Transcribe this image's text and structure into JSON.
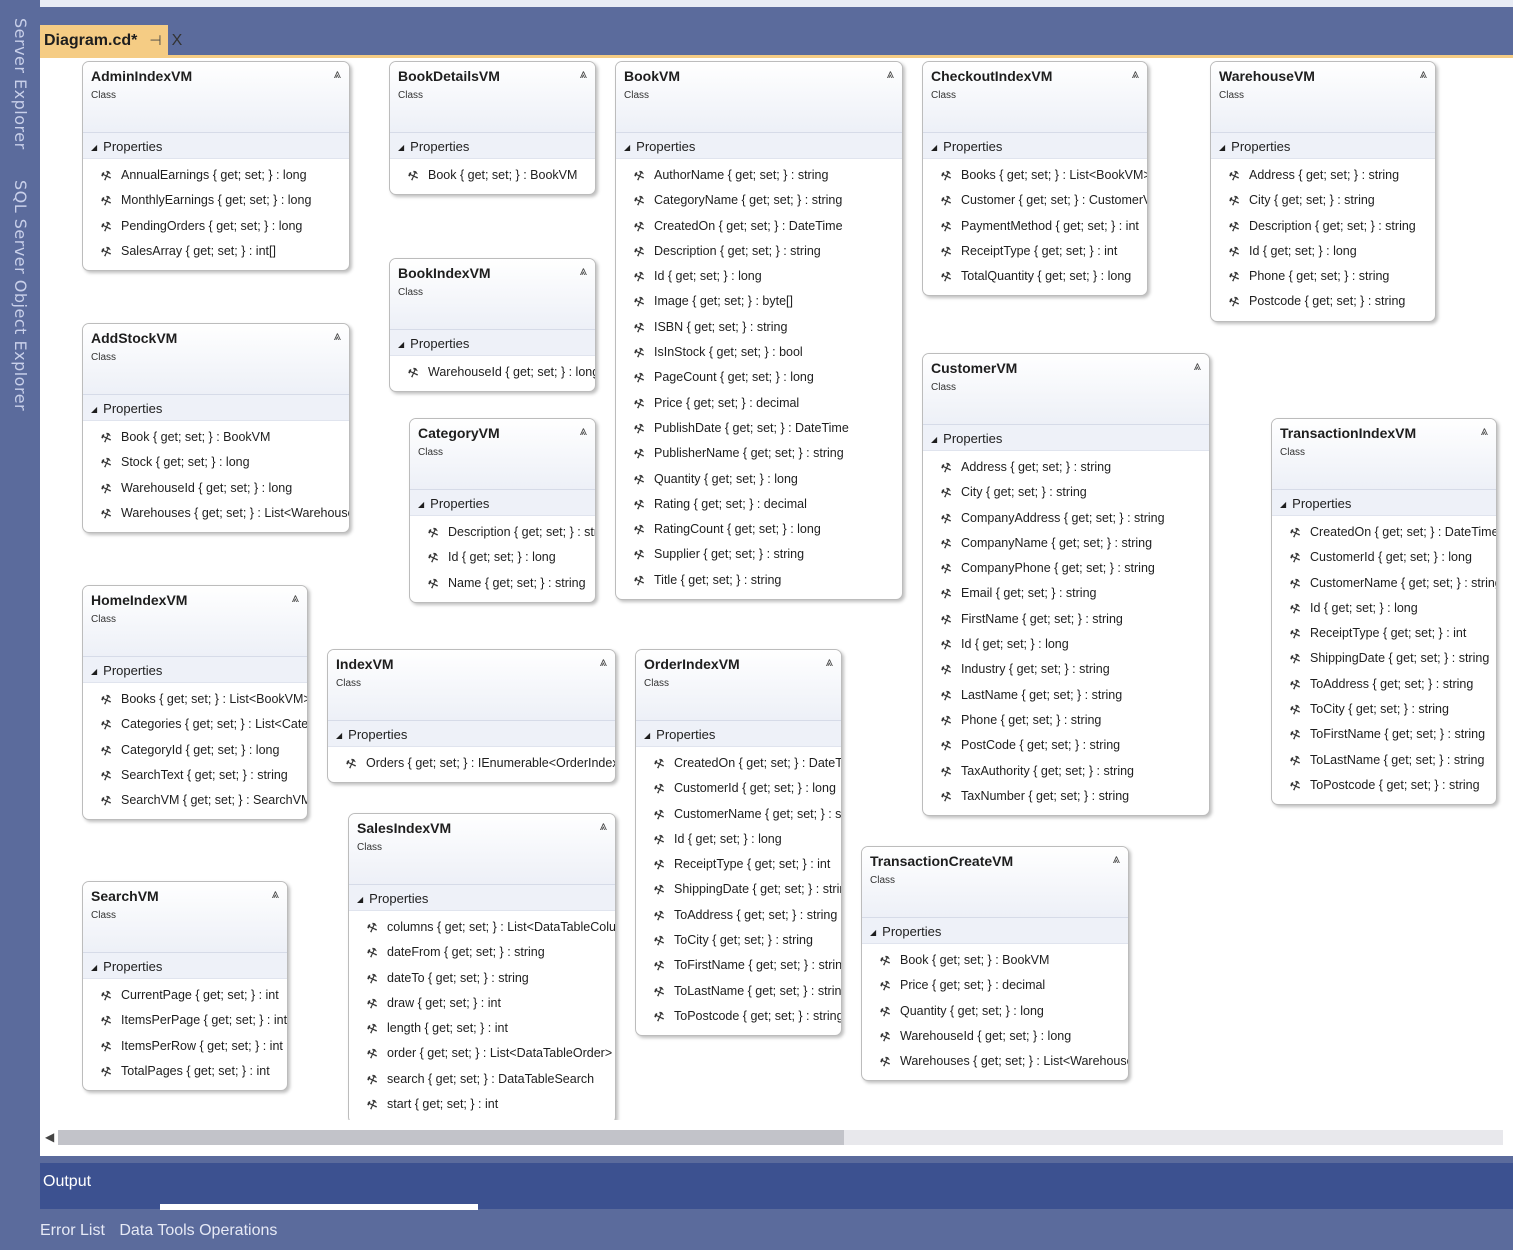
{
  "side_tabs": {
    "server": "Server Explorer",
    "sql": "SQL Server Object Explorer"
  },
  "document_tab": {
    "title": "Diagram.cd*",
    "pin": "⊣",
    "close": "X"
  },
  "section_label": "Properties",
  "class_kind": "Class",
  "classes": {
    "AdminIndexVM": {
      "name": "AdminIndexVM",
      "props": [
        "AnnualEarnings { get; set; } : long",
        "MonthlyEarnings { get; set; } : long",
        "PendingOrders { get; set; } : long",
        "SalesArray { get; set; } : int[]"
      ]
    },
    "AddStockVM": {
      "name": "AddStockVM",
      "props": [
        "Book { get; set; } : BookVM",
        "Stock { get; set; } : long",
        "WarehouseId { get; set; } : long",
        "Warehouses { get; set; } : List<WarehouseVM>"
      ]
    },
    "HomeIndexVM": {
      "name": "HomeIndexVM",
      "props": [
        "Books { get; set; } : List<BookVM>",
        "Categories { get; set; } : List<Category>",
        "CategoryId { get; set; } : long",
        "SearchText { get; set; } : string",
        "SearchVM { get; set; } : SearchVM"
      ]
    },
    "SearchVM": {
      "name": "SearchVM",
      "props": [
        "CurrentPage { get; set; } : int",
        "ItemsPerPage { get; set; } : int",
        "ItemsPerRow { get; set; } : int",
        "TotalPages { get; set; } : int"
      ]
    },
    "BookDetailsVM": {
      "name": "BookDetailsVM",
      "props": [
        "Book { get; set; } : BookVM"
      ]
    },
    "BookIndexVM": {
      "name": "BookIndexVM",
      "props": [
        "WarehouseId { get; set; } : long"
      ]
    },
    "CategoryVM": {
      "name": "CategoryVM",
      "props": [
        "Description { get; set; } : string",
        "Id { get; set; } : long",
        "Name { get; set; } : string"
      ]
    },
    "IndexVM": {
      "name": "IndexVM",
      "props": [
        "Orders { get; set; } : IEnumerable<OrderIndexVM>"
      ]
    },
    "SalesIndexVM": {
      "name": "SalesIndexVM",
      "props": [
        "columns { get; set; } : List<DataTableColumn>",
        "dateFrom { get; set; } : string",
        "dateTo { get; set; } : string",
        "draw { get; set; } : int",
        "length { get; set; } : int",
        "order { get; set; } : List<DataTableOrder>",
        "search { get; set; } : DataTableSearch",
        "start { get; set; } : int"
      ]
    },
    "BookVM": {
      "name": "BookVM",
      "props": [
        "AuthorName { get; set; } : string",
        "CategoryName { get; set; } : string",
        "CreatedOn { get; set; } : DateTime",
        "Description { get; set; } : string",
        "Id { get; set; } : long",
        "Image { get; set; } : byte[]",
        "ISBN { get; set; } : string",
        "IsInStock { get; set; } : bool",
        "PageCount { get; set; } : long",
        "Price { get; set; } : decimal",
        "PublishDate { get; set; } : DateTime",
        "PublisherName { get; set; } : string",
        "Quantity { get; set; } : long",
        "Rating { get; set; } : decimal",
        "RatingCount { get; set; } : long",
        "Supplier { get; set; } : string",
        "Title { get; set; } : string"
      ]
    },
    "OrderIndexVM": {
      "name": "OrderIndexVM",
      "props": [
        "CreatedOn { get; set; } : DateTime",
        "CustomerId { get; set; } : long",
        "CustomerName { get; set; } : string",
        "Id { get; set; } : long",
        "ReceiptType { get; set; } : int",
        "ShippingDate { get; set; } : string",
        "ToAddress { get; set; } : string",
        "ToCity { get; set; } : string",
        "ToFirstName { get; set; } : string",
        "ToLastName { get; set; } : string",
        "ToPostcode { get; set; } : string"
      ]
    },
    "CheckoutIndexVM": {
      "name": "CheckoutIndexVM",
      "props": [
        "Books { get; set; } : List<BookVM>",
        "Customer { get; set; } : CustomerVM",
        "PaymentMethod { get; set; } : int",
        "ReceiptType { get; set; } : int",
        "TotalQuantity { get; set; } : long"
      ]
    },
    "CustomerVM": {
      "name": "CustomerVM",
      "props": [
        "Address { get; set; } : string",
        "City { get; set; } : string",
        "CompanyAddress { get; set; } : string",
        "CompanyName { get; set; } : string",
        "CompanyPhone { get; set; } : string",
        "Email { get; set; } : string",
        "FirstName { get; set; } : string",
        "Id { get; set; } : long",
        "Industry { get; set; } : string",
        "LastName { get; set; } : string",
        "Phone { get; set; } : string",
        "PostCode { get; set; } : string",
        "TaxAuthority { get; set; } : string",
        "TaxNumber { get; set; } : string"
      ]
    },
    "TransactionCreateVM": {
      "name": "TransactionCreateVM",
      "props": [
        "Book { get; set; } : BookVM",
        "Price { get; set; } : decimal",
        "Quantity { get; set; } : long",
        "WarehouseId { get; set; } : long",
        "Warehouses { get; set; } : List<WarehouseVM>"
      ]
    },
    "WarehouseVM": {
      "name": "WarehouseVM",
      "props": [
        "Address { get; set; } : string",
        "City { get; set; } : string",
        "Description { get; set; } : string",
        "Id { get; set; } : long",
        "Phone { get; set; } : string",
        "Postcode { get; set; } : string"
      ]
    },
    "TransactionIndexVM": {
      "name": "TransactionIndexVM",
      "props": [
        "CreatedOn { get; set; } : DateTime",
        "CustomerId { get; set; } : long",
        "CustomerName { get; set; } : string",
        "Id { get; set; } : long",
        "ReceiptType { get; set; } : int",
        "ShippingDate { get; set; } : string",
        "ToAddress { get; set; } : string",
        "ToCity { get; set; } : string",
        "ToFirstName { get; set; } : string",
        "ToLastName { get; set; } : string",
        "ToPostcode { get; set; } : string"
      ]
    }
  },
  "output_panel": {
    "title": "Output"
  },
  "bottom_tabs": [
    "Error List",
    "Data Tools Operations"
  ],
  "icons": {
    "property": "wrench-icon",
    "collapse": "double-chevron-up-icon",
    "section": "triangle-down-icon"
  },
  "colors": {
    "chrome": "#5b6b9c",
    "active_tab": "#f5cc84",
    "output_header": "#3c5190"
  }
}
